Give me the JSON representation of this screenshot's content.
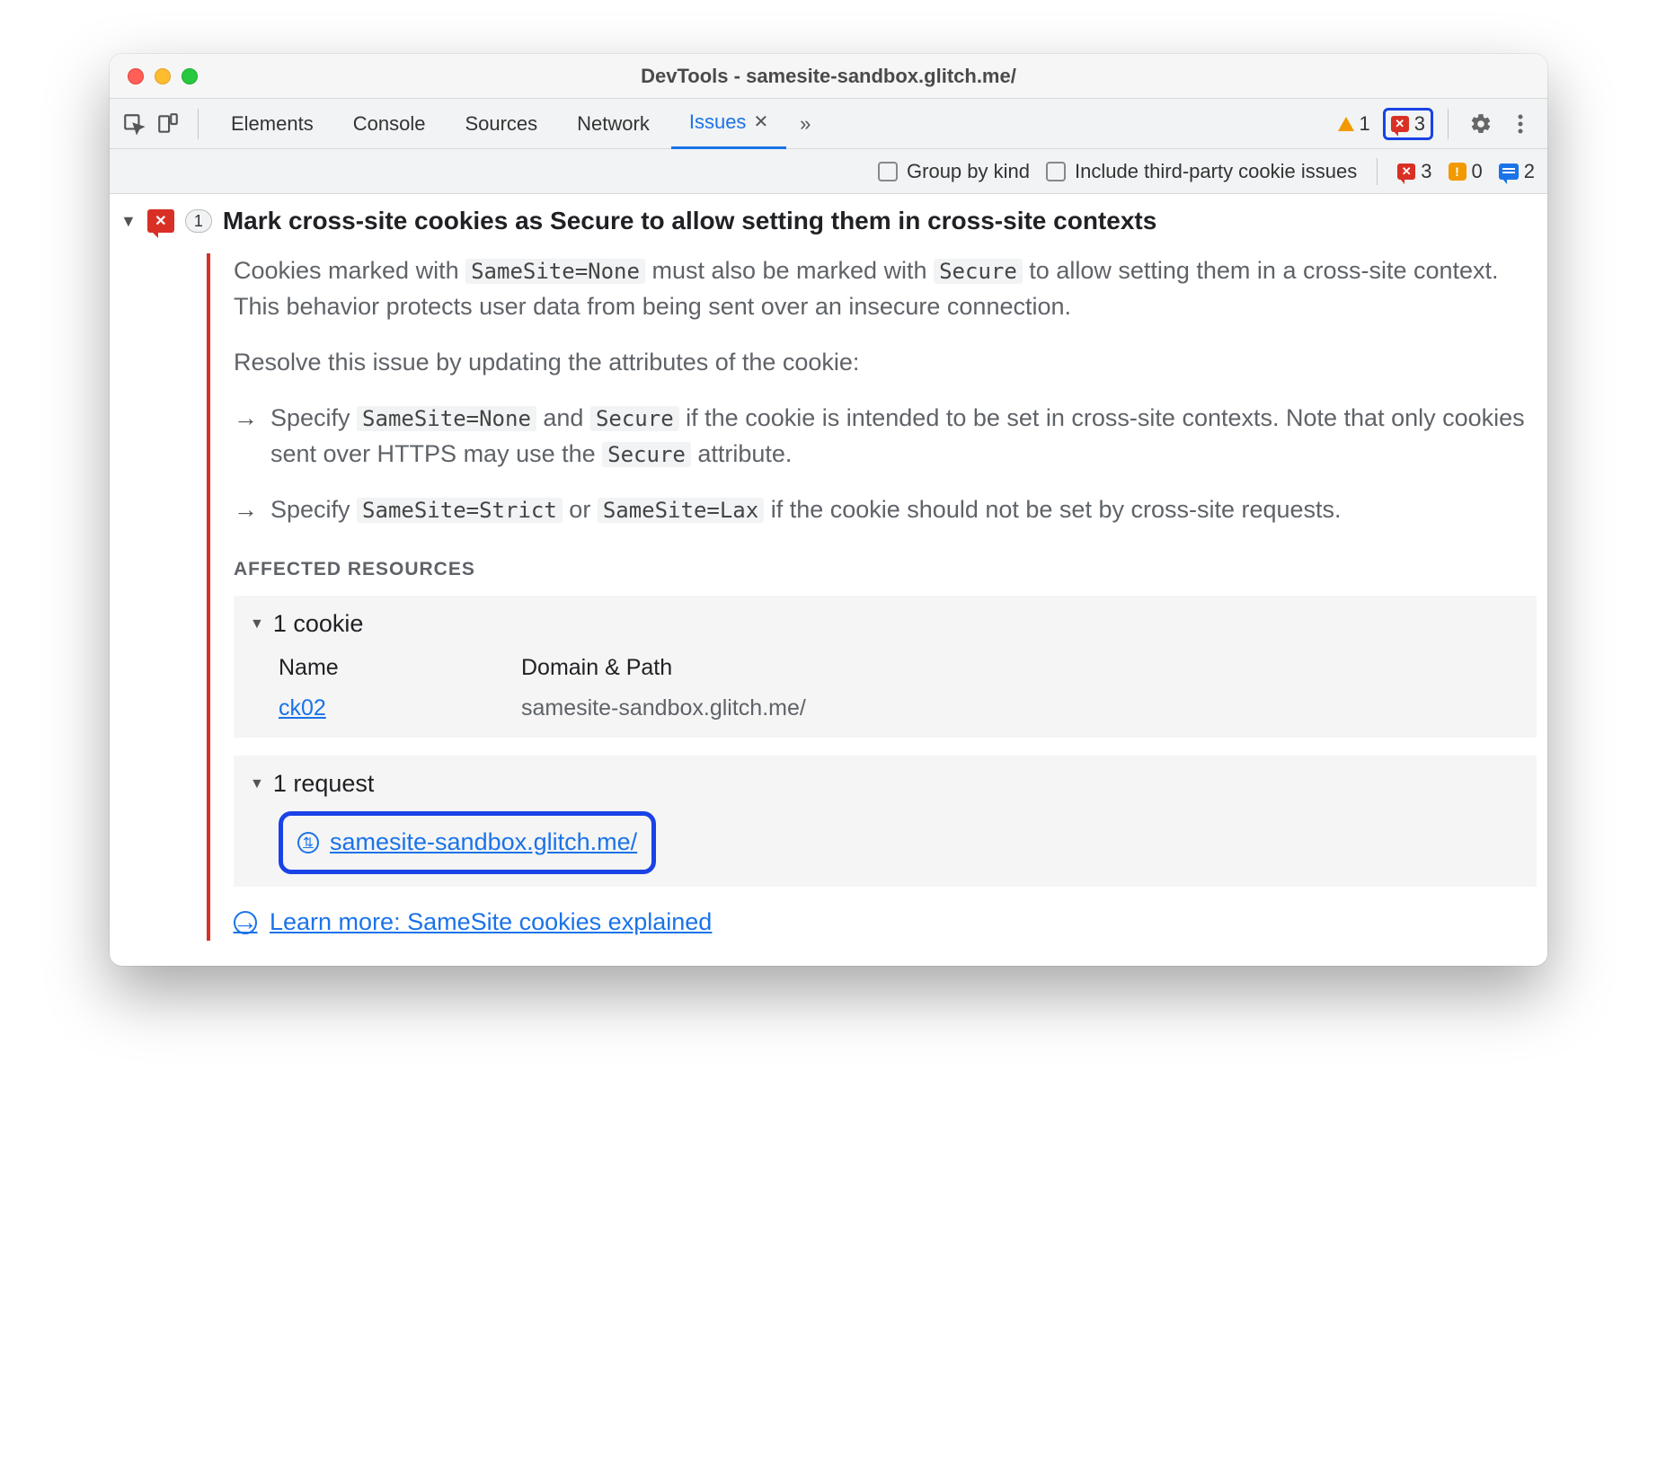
{
  "window": {
    "title": "DevTools - samesite-sandbox.glitch.me/"
  },
  "tabs": {
    "items": [
      "Elements",
      "Console",
      "Sources",
      "Network",
      "Issues"
    ],
    "active": "Issues"
  },
  "toolbar": {
    "warn_count": 1,
    "err_count": 3
  },
  "subbar": {
    "group_by_kind_label": "Group by kind",
    "include_third_party_label": "Include third-party cookie issues",
    "err_count": 3,
    "info_count": 0,
    "msg_count": 2
  },
  "issue": {
    "count": 1,
    "title": "Mark cross-site cookies as Secure to allow setting them in cross-site contexts",
    "desc1a": "Cookies marked with ",
    "desc1b": " must also be marked with ",
    "desc1c": " to allow setting them in a cross-site context. This behavior protects user data from being sent over an insecure connection.",
    "code_ss_none": "SameSite=None",
    "code_secure": "Secure",
    "resolve_intro": "Resolve this issue by updating the attributes of the cookie:",
    "bullet1a": "Specify ",
    "bullet1b": " and ",
    "bullet1c": " if the cookie is intended to be set in cross-site contexts. Note that only cookies sent over HTTPS may use the ",
    "bullet1d": " attribute.",
    "bullet2a": "Specify ",
    "bullet2b": " or ",
    "bullet2c": " if the cookie should not be set by cross-site requests.",
    "code_ss_strict": "SameSite=Strict",
    "code_ss_lax": "SameSite=Lax",
    "affected_heading": "AFFECTED RESOURCES",
    "cookies": {
      "label": "1 cookie",
      "col_name": "Name",
      "col_domain": "Domain & Path",
      "rows": [
        {
          "name": "ck02",
          "domain": "samesite-sandbox.glitch.me/"
        }
      ]
    },
    "requests": {
      "label": "1 request",
      "items": [
        "samesite-sandbox.glitch.me/"
      ]
    },
    "learn_more": "Learn more: SameSite cookies explained"
  }
}
